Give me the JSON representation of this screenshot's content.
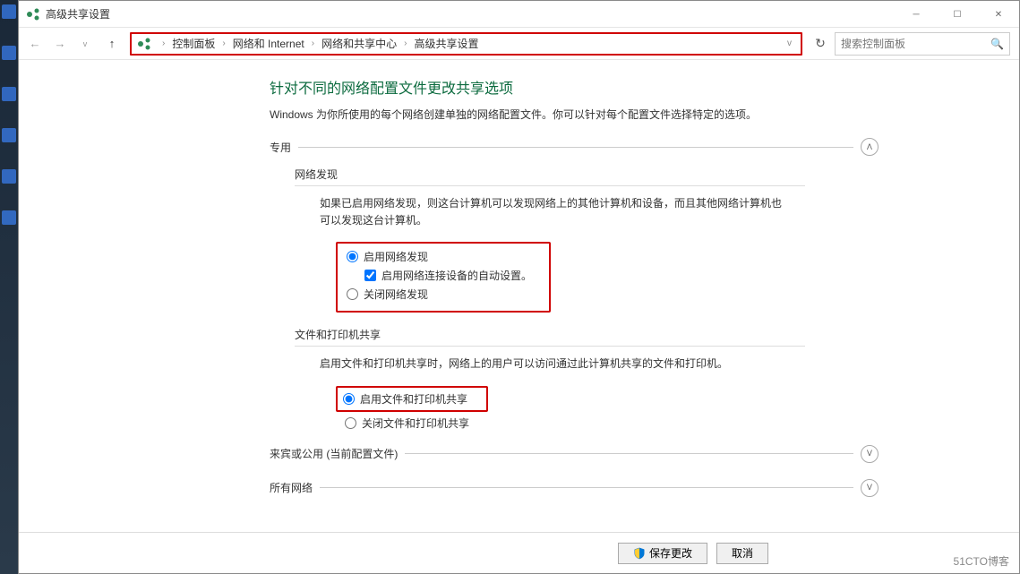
{
  "titlebar": {
    "title": "高级共享设置"
  },
  "breadcrumb": {
    "items": [
      "控制面板",
      "网络和 Internet",
      "网络和共享中心",
      "高级共享设置"
    ]
  },
  "search": {
    "placeholder": "搜索控制面板"
  },
  "page": {
    "title": "针对不同的网络配置文件更改共享选项",
    "desc": "Windows 为你所使用的每个网络创建单独的网络配置文件。你可以针对每个配置文件选择特定的选项。"
  },
  "sections": {
    "private": {
      "label": "专用",
      "netdiscovery": {
        "label": "网络发现",
        "desc": "如果已启用网络发现，则这台计算机可以发现网络上的其他计算机和设备，而且其他网络计算机也可以发现这台计算机。",
        "opt_on": "启用网络发现",
        "opt_auto": "启用网络连接设备的自动设置。",
        "opt_off": "关闭网络发现"
      },
      "fileshare": {
        "label": "文件和打印机共享",
        "desc": "启用文件和打印机共享时，网络上的用户可以访问通过此计算机共享的文件和打印机。",
        "opt_on": "启用文件和打印机共享",
        "opt_off": "关闭文件和打印机共享"
      }
    },
    "guest": {
      "label": "来宾或公用 (当前配置文件)"
    },
    "all": {
      "label": "所有网络"
    }
  },
  "footer": {
    "save": "保存更改",
    "cancel": "取消"
  },
  "watermark": "51CTO博客"
}
